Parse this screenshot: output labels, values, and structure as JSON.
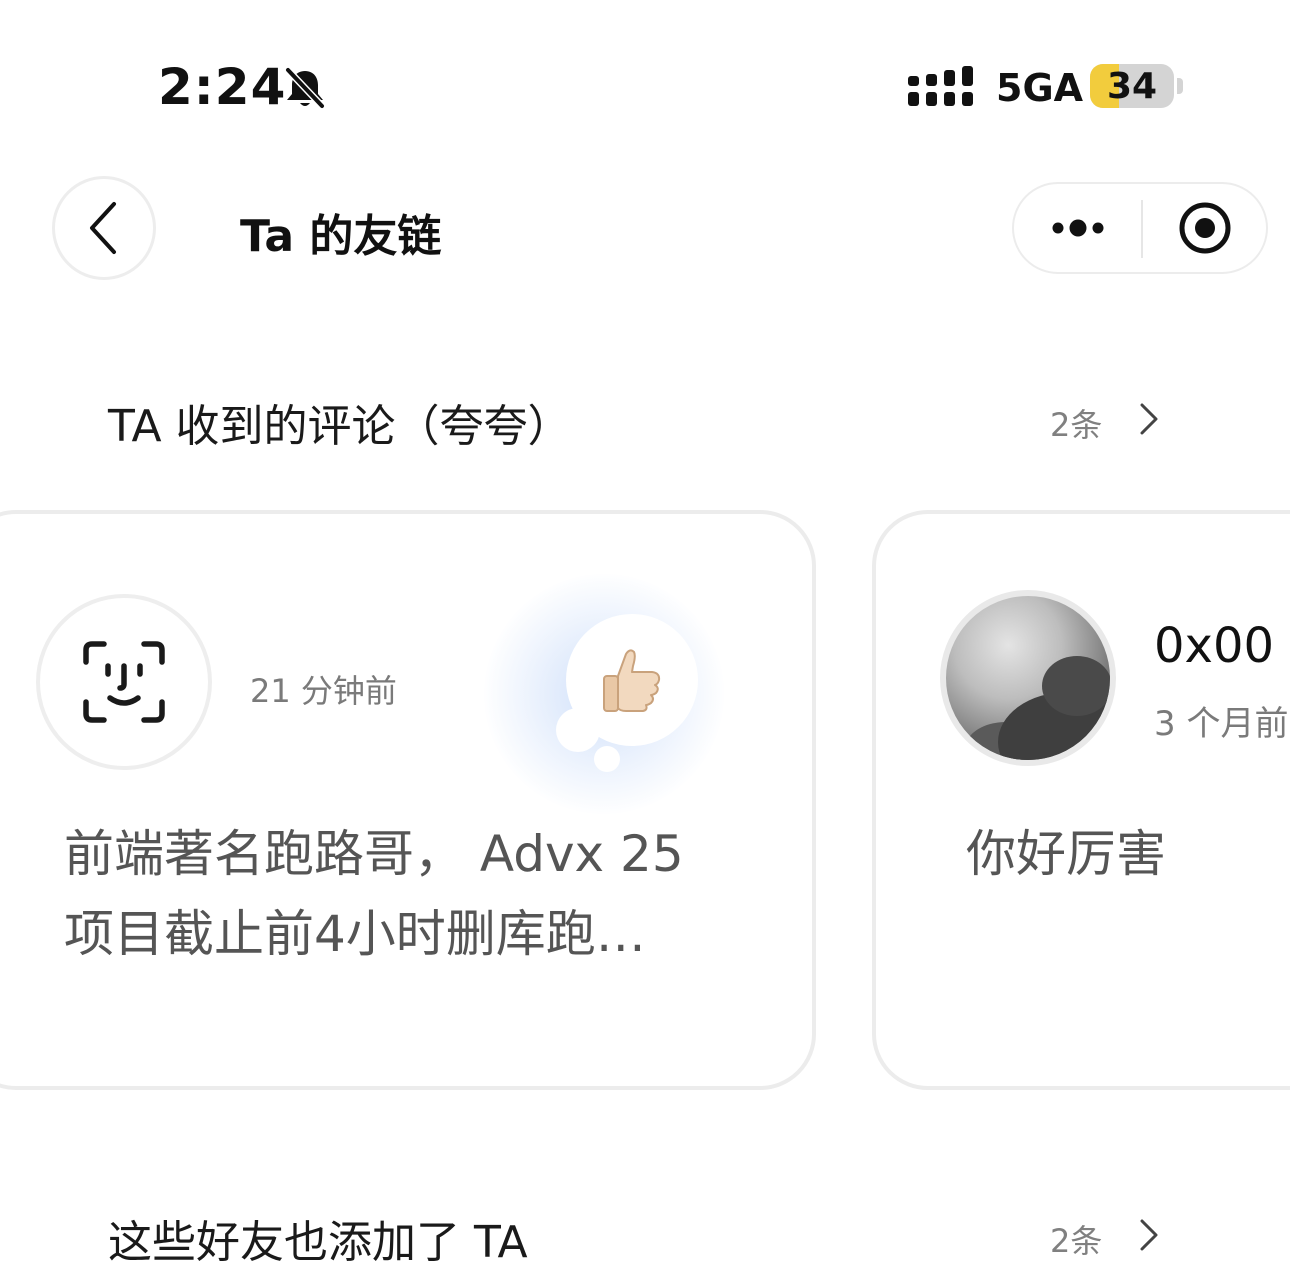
{
  "status_bar": {
    "time": "2:24",
    "network": "5GA",
    "battery": "34",
    "battery_level": 0.34,
    "icons": [
      "bell-slash-icon",
      "signal-icon",
      "battery-icon"
    ]
  },
  "nav": {
    "title": "Ta 的友链",
    "icons": [
      "back-chevron-icon",
      "more-dots-icon",
      "close-target-icon"
    ]
  },
  "comments_section": {
    "title": "TA 收到的评论（夸夸）",
    "count": "2条",
    "icon": "chevron-right-icon"
  },
  "comment_cards": [
    {
      "avatar_icon": "face-id-icon",
      "time": "21 分钟前",
      "reaction_icon": "thumbs-up-icon",
      "reaction": "👍🏻",
      "text": "前端著名跑路哥， Advx 25 项目截止前4小时删库跑…"
    },
    {
      "avatar_icon": "cloud-photo-avatar",
      "name": "0x00",
      "time": "3 个月前",
      "text": "你好厉害"
    }
  ],
  "friends_section": {
    "title": "这些好友也添加了 TA",
    "count": "2条",
    "icon": "chevron-right-icon"
  },
  "colors": {
    "card_border": "#ececec",
    "secondary_text": "#808080",
    "battery_fill": "#f2cc3d",
    "reaction_glow": "#cddefa"
  }
}
